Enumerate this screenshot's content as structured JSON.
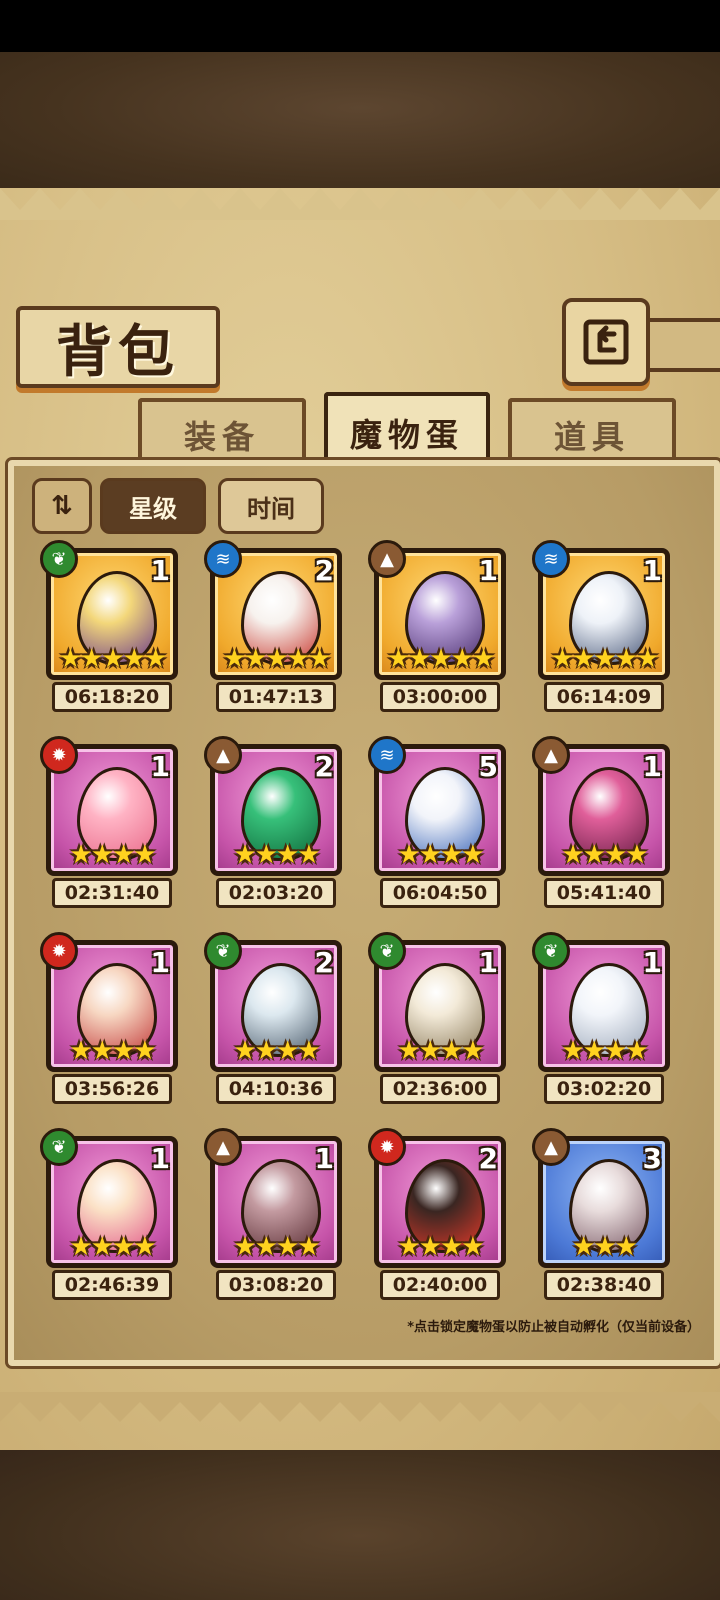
{
  "header": {
    "title": "背包"
  },
  "tabs": [
    {
      "label": "装备",
      "active": false
    },
    {
      "label": "魔物蛋",
      "active": true
    },
    {
      "label": "道具",
      "active": false
    }
  ],
  "sort": {
    "options": [
      "星级",
      "时间"
    ],
    "selected": "星级"
  },
  "eggs": [
    {
      "count": "1",
      "stars": "★★★★★",
      "time": "06:18:20",
      "element": "leaf-icon",
      "rarity": "gold"
    },
    {
      "count": "2",
      "stars": "★★★★★",
      "time": "01:47:13",
      "element": "water-icon",
      "rarity": "gold"
    },
    {
      "count": "1",
      "stars": "★★★★★",
      "time": "03:00:00",
      "element": "earth-icon",
      "rarity": "gold"
    },
    {
      "count": "1",
      "stars": "★★★★★",
      "time": "06:14:09",
      "element": "water-icon",
      "rarity": "gold"
    },
    {
      "count": "1",
      "stars": "★★★★",
      "time": "02:31:40",
      "element": "fire-icon",
      "rarity": "purple"
    },
    {
      "count": "2",
      "stars": "★★★★",
      "time": "02:03:20",
      "element": "earth-icon",
      "rarity": "purple"
    },
    {
      "count": "5",
      "stars": "★★★★",
      "time": "06:04:50",
      "element": "water-icon",
      "rarity": "purple"
    },
    {
      "count": "1",
      "stars": "★★★★",
      "time": "05:41:40",
      "element": "earth-icon",
      "rarity": "purple"
    },
    {
      "count": "1",
      "stars": "★★★★",
      "time": "03:56:26",
      "element": "fire-icon",
      "rarity": "purple"
    },
    {
      "count": "2",
      "stars": "★★★★",
      "time": "04:10:36",
      "element": "leaf-icon",
      "rarity": "purple"
    },
    {
      "count": "1",
      "stars": "★★★★",
      "time": "02:36:00",
      "element": "leaf-icon",
      "rarity": "purple"
    },
    {
      "count": "1",
      "stars": "★★★★",
      "time": "03:02:20",
      "element": "leaf-icon",
      "rarity": "purple"
    },
    {
      "count": "1",
      "stars": "★★★★",
      "time": "02:46:39",
      "element": "leaf-icon",
      "rarity": "purple"
    },
    {
      "count": "1",
      "stars": "★★★★",
      "time": "03:08:20",
      "element": "earth-icon",
      "rarity": "purple"
    },
    {
      "count": "2",
      "stars": "★★★★",
      "time": "02:40:00",
      "element": "fire-icon",
      "rarity": "purple"
    },
    {
      "count": "3",
      "stars": "★★★",
      "time": "02:38:40",
      "element": "earth-icon",
      "rarity": "blue"
    }
  ],
  "footnote": "*点击锁定魔物蛋以防止被自动孵化（仅当前设备）",
  "colors": {
    "leaf": "#2f8a2f",
    "water": "#1f76c9",
    "fire": "#d0281e",
    "earth": "#8a5a33"
  }
}
